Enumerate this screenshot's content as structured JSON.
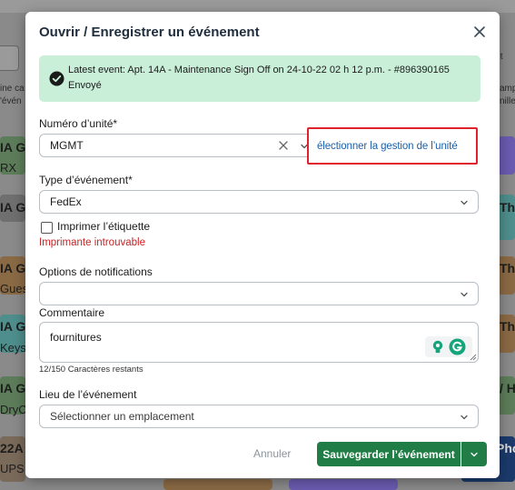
{
  "background": {
    "left_col": [
      {
        "title": "IA G",
        "sub": "RX"
      },
      {
        "title": "IA G",
        "sub": ""
      },
      {
        "title": "IA G",
        "sub": "Gues"
      },
      {
        "title": "IA G",
        "sub": "Keys"
      },
      {
        "title": "IA G",
        "sub": "DryC"
      },
      {
        "title": "22A (",
        "sub": "UPS"
      }
    ],
    "left_snippets": [
      "ine ca",
      "'évén"
    ],
    "right_snippets": [
      "The",
      "The",
      "The",
      "/ H",
      "Pho"
    ],
    "right_top": [
      "ıt",
      "amp",
      "nille"
    ],
    "colors": {
      "overlay": "#8a8a8a",
      "green": "#6f8f6a",
      "purple": "#6b5bb0",
      "brown": "#8a6a45",
      "teal": "#4e8e8c"
    }
  },
  "modal": {
    "title": "Ouvrir / Enregistrer un événement",
    "close_icon": "close-icon",
    "alert": {
      "icon": "check-circle-icon",
      "text": "Latest event: Apt. 14A - Maintenance Sign Off on 24-10-22 02 h 12 p.m. - #896390165 Envoyé"
    },
    "unit": {
      "label": "Numéro d’unité*",
      "value": "MGMT",
      "link": "électionner la gestion de l’unité"
    },
    "event_type": {
      "label": "Type d’événement*",
      "value": "FedEx"
    },
    "print": {
      "label": "Imprimer l’étiquette",
      "checked": false,
      "error": "Imprimante introuvable"
    },
    "notifications": {
      "label": "Options de notifications",
      "value": ""
    },
    "comment": {
      "label": "Commentaire",
      "value": "fournitures",
      "counter": "12/150 Caractères restants"
    },
    "location": {
      "label": "Lieu de l’événement",
      "placeholder": "Sélectionner un emplacement"
    },
    "actions": {
      "cancel": "Annuler",
      "save": "Sauvegarder l’événement"
    },
    "colors": {
      "primary": "#1f7d45",
      "alert_bg": "#c9efd9",
      "error": "#cc1f1f",
      "link": "#1d5fa8",
      "highlight": "#e0222d"
    }
  }
}
